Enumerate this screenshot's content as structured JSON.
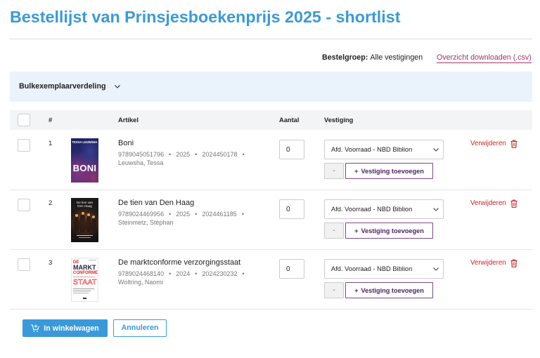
{
  "page": {
    "title": "Bestellijst van Prinsjesboekenprijs 2025 - shortlist"
  },
  "order_group": {
    "label": "Bestelgroep:",
    "value": "Alle vestigingen"
  },
  "download_link": "Overzicht downloaden (.csv)",
  "bulk_distribution": {
    "label": "Bulkexemplaarverdeling",
    "icon": "chevron-down-icon"
  },
  "table": {
    "columns": {
      "number": "#",
      "article": "Artikel",
      "quantity": "Aantal",
      "location": "Vestiging"
    },
    "meta_separator": "•",
    "remove_label": "Verwijderen",
    "remove_icon": "trash-icon",
    "remove_location_label": "-",
    "add_location_prefix": "+",
    "add_location_label": "Vestiging toevoegen",
    "rows": [
      {
        "number": "1",
        "checked": false,
        "title": "Boni",
        "isbn": "9789045051796",
        "year": "2025",
        "code": "2024450178",
        "author": "Leuwsha, Tessa",
        "quantity": "0",
        "location": "Afd. Voorraad - NBD Biblion",
        "cover": {
          "author": "TESSA LEUWSHA",
          "title": "BONI"
        }
      },
      {
        "number": "2",
        "checked": false,
        "title": "De tien van Den Haag",
        "isbn": "9789024469956",
        "year": "2025",
        "code": "2024461185",
        "author": "Steinmetz, Stephan",
        "quantity": "0",
        "location": "Afd. Voorraad - NBD Biblion",
        "cover": {
          "lines": [
            "De tien van",
            "Den Haag"
          ]
        }
      },
      {
        "number": "3",
        "checked": false,
        "title": "De marktconforme verzorgingsstaat",
        "isbn": "9789024468140",
        "year": "2024",
        "code": "2024230232",
        "author": "Woltring, Naomi",
        "quantity": "0",
        "location": "Afd. Voorraad - NBD Biblion",
        "cover": {
          "lines": [
            "DE",
            "MARKT",
            "CONFORME",
            "STAAT"
          ]
        }
      }
    ]
  },
  "actions": {
    "add_to_cart": {
      "label": "In winkelwagen",
      "icon": "cart-plus-icon"
    },
    "cancel": {
      "label": "Annuleren"
    }
  },
  "colors": {
    "primary": "#3a9ad9",
    "link": "#a3336f",
    "accent_purple": "#7b4a86",
    "danger": "#c62828",
    "panel": "#eaf3fb",
    "header_bg": "#f3f4f6"
  }
}
